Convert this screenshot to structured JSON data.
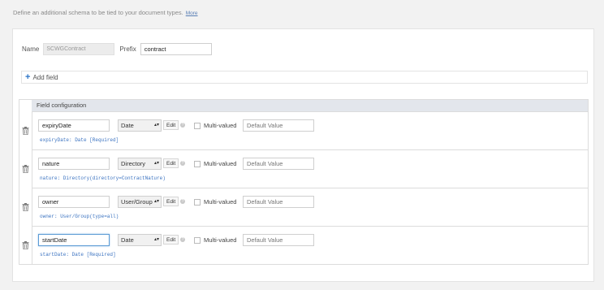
{
  "intro": {
    "text": "Define an additional schema to be tied to your document types.",
    "more_link": "More"
  },
  "schema": {
    "name_label": "Name",
    "name_value": "SCWGContract",
    "prefix_label": "Prefix",
    "prefix_value": "contract"
  },
  "add_field_label": "Add field",
  "table": {
    "header": "Field configuration",
    "edit_label": "Edit",
    "help_glyph": "?",
    "multivalued_label": "Multi-valued",
    "default_placeholder": "Default Value",
    "rows": [
      {
        "name": "expiryDate",
        "type": "Date",
        "summary": "expiryDate: Date [Required]"
      },
      {
        "name": "nature",
        "type": "Directory",
        "summary": "nature: Directory(directory=ContractNature)"
      },
      {
        "name": "owner",
        "type": "User/Group",
        "summary": "owner: User/Group(type=all)"
      },
      {
        "name": "startDate",
        "type": "Date",
        "summary": "startDate: Date [Required]"
      }
    ]
  },
  "colors": {
    "accent": "#2a73c6",
    "summary_text": "#3a72c0",
    "header_bg": "#e3e6ec"
  },
  "icons": {
    "add": "plus-icon",
    "delete": "trash-icon",
    "dropdown": "updown-arrow-icon",
    "help": "help-icon"
  }
}
